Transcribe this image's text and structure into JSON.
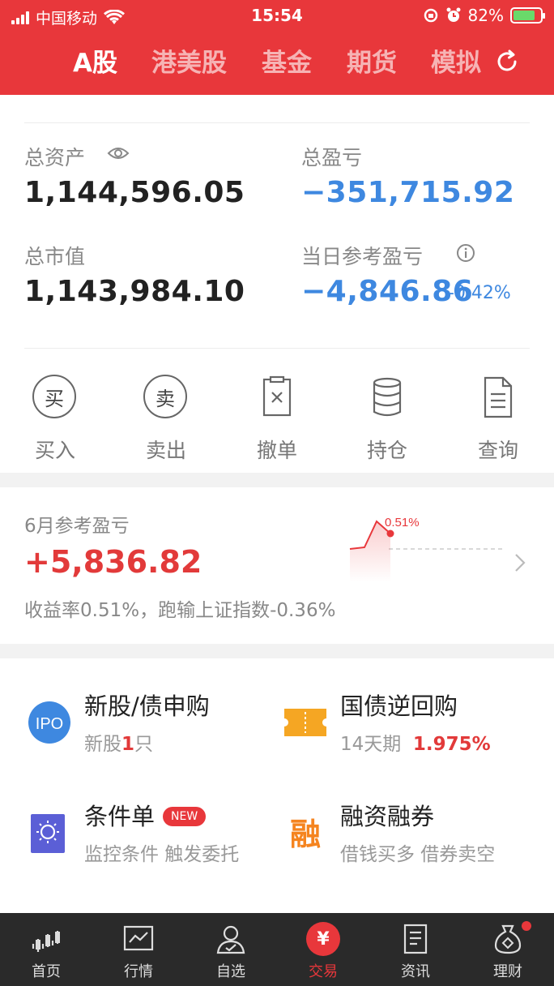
{
  "status_bar": {
    "carrier": "中国移动",
    "time": "15:54",
    "battery_pct": "82%"
  },
  "tabs": [
    {
      "label": "A股",
      "active": true
    },
    {
      "label": "港美股",
      "active": false
    },
    {
      "label": "基金",
      "active": false
    },
    {
      "label": "期货",
      "active": false
    },
    {
      "label": "模拟",
      "active": false
    }
  ],
  "summary": {
    "total_assets_label": "总资产",
    "total_assets": "1,144,596.05",
    "total_pnl_label": "总盈亏",
    "total_pnl": "−351,715.92",
    "market_value_label": "总市值",
    "market_value": "1,143,984.10",
    "daily_pnl_label": "当日参考盈亏",
    "daily_pnl": "−4,846.86",
    "daily_pnl_pct": "-0.42%"
  },
  "actions": [
    {
      "label": "买入",
      "glyph": "买",
      "icon": "buy-icon"
    },
    {
      "label": "卖出",
      "glyph": "卖",
      "icon": "sell-icon"
    },
    {
      "label": "撤单",
      "icon": "cancel-order-icon"
    },
    {
      "label": "持仓",
      "icon": "position-icon"
    },
    {
      "label": "查询",
      "icon": "query-icon"
    }
  ],
  "monthly": {
    "label": "6月参考盈亏",
    "value": "+5,836.82",
    "subtitle": "收益率0.51%，跑输上证指数-0.36%",
    "spark_label": "0.51%"
  },
  "services": [
    {
      "title": "新股/债申购",
      "sub_prefix": "新股",
      "sub_num": "1",
      "sub_suffix": "只",
      "icon": "ipo-icon",
      "icon_text": "IPO"
    },
    {
      "title": "国债逆回购",
      "sub_prefix": "14天期",
      "sub_num": "1.975%",
      "icon": "ticket-icon"
    },
    {
      "title": "条件单",
      "badge": "NEW",
      "sub": "监控条件 触发委托",
      "icon": "condition-order-icon"
    },
    {
      "title": "融资融券",
      "sub": "借钱买多 借券卖空",
      "icon": "margin-icon",
      "icon_text": "融"
    }
  ],
  "bottom_nav": [
    {
      "label": "首页",
      "icon": "home-icon"
    },
    {
      "label": "行情",
      "icon": "market-icon"
    },
    {
      "label": "自选",
      "icon": "watchlist-icon"
    },
    {
      "label": "交易",
      "icon": "trade-icon",
      "active": true,
      "glyph": "¥"
    },
    {
      "label": "资讯",
      "icon": "news-icon"
    },
    {
      "label": "理财",
      "icon": "wealth-icon"
    }
  ],
  "colors": {
    "brand_red": "#e8373b",
    "loss_blue": "#3e88e0",
    "nav_bg": "#2a2a2a"
  }
}
